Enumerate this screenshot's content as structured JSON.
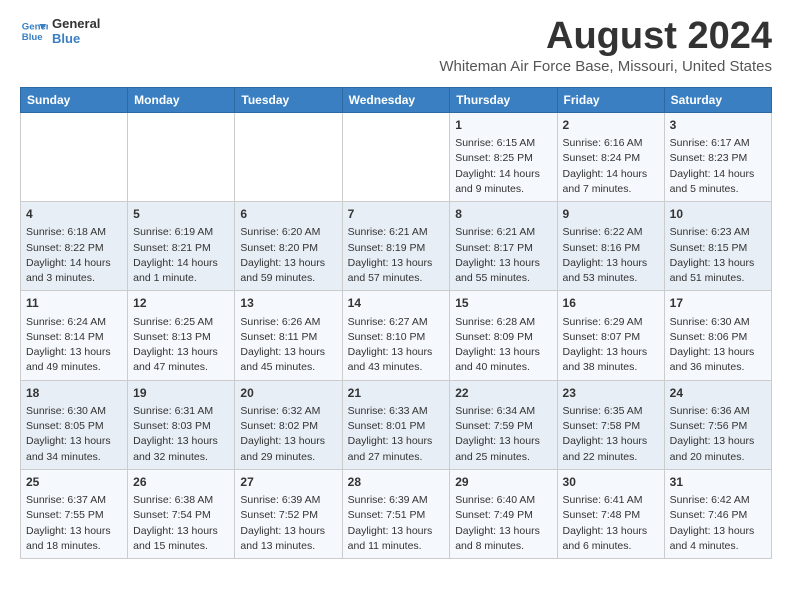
{
  "logo": {
    "line1": "General",
    "line2": "Blue"
  },
  "title": "August 2024",
  "subtitle": "Whiteman Air Force Base, Missouri, United States",
  "days_of_week": [
    "Sunday",
    "Monday",
    "Tuesday",
    "Wednesday",
    "Thursday",
    "Friday",
    "Saturday"
  ],
  "weeks": [
    [
      {
        "day": "",
        "content": ""
      },
      {
        "day": "",
        "content": ""
      },
      {
        "day": "",
        "content": ""
      },
      {
        "day": "",
        "content": ""
      },
      {
        "day": "1",
        "content": "Sunrise: 6:15 AM\nSunset: 8:25 PM\nDaylight: 14 hours\nand 9 minutes."
      },
      {
        "day": "2",
        "content": "Sunrise: 6:16 AM\nSunset: 8:24 PM\nDaylight: 14 hours\nand 7 minutes."
      },
      {
        "day": "3",
        "content": "Sunrise: 6:17 AM\nSunset: 8:23 PM\nDaylight: 14 hours\nand 5 minutes."
      }
    ],
    [
      {
        "day": "4",
        "content": "Sunrise: 6:18 AM\nSunset: 8:22 PM\nDaylight: 14 hours\nand 3 minutes."
      },
      {
        "day": "5",
        "content": "Sunrise: 6:19 AM\nSunset: 8:21 PM\nDaylight: 14 hours\nand 1 minute."
      },
      {
        "day": "6",
        "content": "Sunrise: 6:20 AM\nSunset: 8:20 PM\nDaylight: 13 hours\nand 59 minutes."
      },
      {
        "day": "7",
        "content": "Sunrise: 6:21 AM\nSunset: 8:19 PM\nDaylight: 13 hours\nand 57 minutes."
      },
      {
        "day": "8",
        "content": "Sunrise: 6:21 AM\nSunset: 8:17 PM\nDaylight: 13 hours\nand 55 minutes."
      },
      {
        "day": "9",
        "content": "Sunrise: 6:22 AM\nSunset: 8:16 PM\nDaylight: 13 hours\nand 53 minutes."
      },
      {
        "day": "10",
        "content": "Sunrise: 6:23 AM\nSunset: 8:15 PM\nDaylight: 13 hours\nand 51 minutes."
      }
    ],
    [
      {
        "day": "11",
        "content": "Sunrise: 6:24 AM\nSunset: 8:14 PM\nDaylight: 13 hours\nand 49 minutes."
      },
      {
        "day": "12",
        "content": "Sunrise: 6:25 AM\nSunset: 8:13 PM\nDaylight: 13 hours\nand 47 minutes."
      },
      {
        "day": "13",
        "content": "Sunrise: 6:26 AM\nSunset: 8:11 PM\nDaylight: 13 hours\nand 45 minutes."
      },
      {
        "day": "14",
        "content": "Sunrise: 6:27 AM\nSunset: 8:10 PM\nDaylight: 13 hours\nand 43 minutes."
      },
      {
        "day": "15",
        "content": "Sunrise: 6:28 AM\nSunset: 8:09 PM\nDaylight: 13 hours\nand 40 minutes."
      },
      {
        "day": "16",
        "content": "Sunrise: 6:29 AM\nSunset: 8:07 PM\nDaylight: 13 hours\nand 38 minutes."
      },
      {
        "day": "17",
        "content": "Sunrise: 6:30 AM\nSunset: 8:06 PM\nDaylight: 13 hours\nand 36 minutes."
      }
    ],
    [
      {
        "day": "18",
        "content": "Sunrise: 6:30 AM\nSunset: 8:05 PM\nDaylight: 13 hours\nand 34 minutes."
      },
      {
        "day": "19",
        "content": "Sunrise: 6:31 AM\nSunset: 8:03 PM\nDaylight: 13 hours\nand 32 minutes."
      },
      {
        "day": "20",
        "content": "Sunrise: 6:32 AM\nSunset: 8:02 PM\nDaylight: 13 hours\nand 29 minutes."
      },
      {
        "day": "21",
        "content": "Sunrise: 6:33 AM\nSunset: 8:01 PM\nDaylight: 13 hours\nand 27 minutes."
      },
      {
        "day": "22",
        "content": "Sunrise: 6:34 AM\nSunset: 7:59 PM\nDaylight: 13 hours\nand 25 minutes."
      },
      {
        "day": "23",
        "content": "Sunrise: 6:35 AM\nSunset: 7:58 PM\nDaylight: 13 hours\nand 22 minutes."
      },
      {
        "day": "24",
        "content": "Sunrise: 6:36 AM\nSunset: 7:56 PM\nDaylight: 13 hours\nand 20 minutes."
      }
    ],
    [
      {
        "day": "25",
        "content": "Sunrise: 6:37 AM\nSunset: 7:55 PM\nDaylight: 13 hours\nand 18 minutes."
      },
      {
        "day": "26",
        "content": "Sunrise: 6:38 AM\nSunset: 7:54 PM\nDaylight: 13 hours\nand 15 minutes."
      },
      {
        "day": "27",
        "content": "Sunrise: 6:39 AM\nSunset: 7:52 PM\nDaylight: 13 hours\nand 13 minutes."
      },
      {
        "day": "28",
        "content": "Sunrise: 6:39 AM\nSunset: 7:51 PM\nDaylight: 13 hours\nand 11 minutes."
      },
      {
        "day": "29",
        "content": "Sunrise: 6:40 AM\nSunset: 7:49 PM\nDaylight: 13 hours\nand 8 minutes."
      },
      {
        "day": "30",
        "content": "Sunrise: 6:41 AM\nSunset: 7:48 PM\nDaylight: 13 hours\nand 6 minutes."
      },
      {
        "day": "31",
        "content": "Sunrise: 6:42 AM\nSunset: 7:46 PM\nDaylight: 13 hours\nand 4 minutes."
      }
    ]
  ]
}
